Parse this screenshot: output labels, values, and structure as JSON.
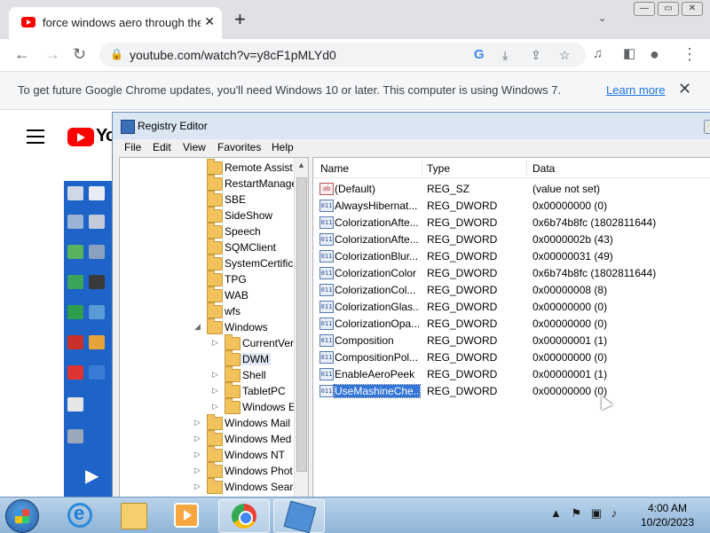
{
  "browser": {
    "tab_title": "force windows aero through the",
    "url": "youtube.com/watch?v=y8cF1pMLYd0",
    "infobar_message": "To get future Google Chrome updates, you'll need Windows 10 or later. This computer is using Windows 7.",
    "infobar_link": "Learn more"
  },
  "youtube": {
    "logo_text": "Yo"
  },
  "regedit": {
    "title": "Registry Editor",
    "menu": [
      "File",
      "Edit",
      "View",
      "Favorites",
      "Help"
    ],
    "tree": [
      {
        "label": "Remote Assist",
        "level": 1,
        "arrow": ""
      },
      {
        "label": "RestartManage",
        "level": 1,
        "arrow": ""
      },
      {
        "label": "SBE",
        "level": 1,
        "arrow": ""
      },
      {
        "label": "SideShow",
        "level": 1,
        "arrow": ""
      },
      {
        "label": "Speech",
        "level": 1,
        "arrow": ""
      },
      {
        "label": "SQMClient",
        "level": 1,
        "arrow": ""
      },
      {
        "label": "SystemCertific",
        "level": 1,
        "arrow": ""
      },
      {
        "label": "TPG",
        "level": 1,
        "arrow": ""
      },
      {
        "label": "WAB",
        "level": 1,
        "arrow": ""
      },
      {
        "label": "wfs",
        "level": 1,
        "arrow": ""
      },
      {
        "label": "Windows",
        "level": 1,
        "arrow": "◢"
      },
      {
        "label": "CurrentVer",
        "level": 2,
        "arrow": "▷"
      },
      {
        "label": "DWM",
        "level": 2,
        "arrow": ""
      },
      {
        "label": "Shell",
        "level": 2,
        "arrow": "▷"
      },
      {
        "label": "TabletPC",
        "level": 2,
        "arrow": "▷"
      },
      {
        "label": "Windows E",
        "level": 2,
        "arrow": "▷"
      },
      {
        "label": "Windows Mail",
        "level": 1,
        "arrow": "▷"
      },
      {
        "label": "Windows Med",
        "level": 1,
        "arrow": "▷"
      },
      {
        "label": "Windows NT",
        "level": 1,
        "arrow": "▷"
      },
      {
        "label": "Windows Phot",
        "level": 1,
        "arrow": "▷"
      },
      {
        "label": "Windows Sear",
        "level": 1,
        "arrow": "▷"
      }
    ],
    "columns": {
      "name": "Name",
      "type": "Type",
      "data": "Data"
    },
    "values": [
      {
        "name": "(Default)",
        "type": "REG_SZ",
        "data": "(value not set)",
        "icon": "ab"
      },
      {
        "name": "AlwaysHibernat...",
        "type": "REG_DWORD",
        "data": "0x00000000 (0)",
        "icon": "011"
      },
      {
        "name": "ColorizationAfte...",
        "type": "REG_DWORD",
        "data": "0x6b74b8fc (1802811644)",
        "icon": "011"
      },
      {
        "name": "ColorizationAfte...",
        "type": "REG_DWORD",
        "data": "0x0000002b (43)",
        "icon": "011"
      },
      {
        "name": "ColorizationBlur...",
        "type": "REG_DWORD",
        "data": "0x00000031 (49)",
        "icon": "011"
      },
      {
        "name": "ColorizationColor",
        "type": "REG_DWORD",
        "data": "0x6b74b8fc (1802811644)",
        "icon": "011"
      },
      {
        "name": "ColorizationCol...",
        "type": "REG_DWORD",
        "data": "0x00000008 (8)",
        "icon": "011"
      },
      {
        "name": "ColorizationGlas...",
        "type": "REG_DWORD",
        "data": "0x00000000 (0)",
        "icon": "011"
      },
      {
        "name": "ColorizationOpa...",
        "type": "REG_DWORD",
        "data": "0x00000000 (0)",
        "icon": "011"
      },
      {
        "name": "Composition",
        "type": "REG_DWORD",
        "data": "0x00000001 (1)",
        "icon": "011"
      },
      {
        "name": "CompositionPol...",
        "type": "REG_DWORD",
        "data": "0x00000000 (0)",
        "icon": "011"
      },
      {
        "name": "EnableAeroPeek",
        "type": "REG_DWORD",
        "data": "0x00000001 (1)",
        "icon": "011"
      },
      {
        "name": "UseMashineChe...",
        "type": "REG_DWORD",
        "data": "0x00000000 (0)",
        "icon": "011"
      }
    ]
  },
  "taskbar": {
    "time": "4:00 AM",
    "date": "10/20/2023"
  }
}
